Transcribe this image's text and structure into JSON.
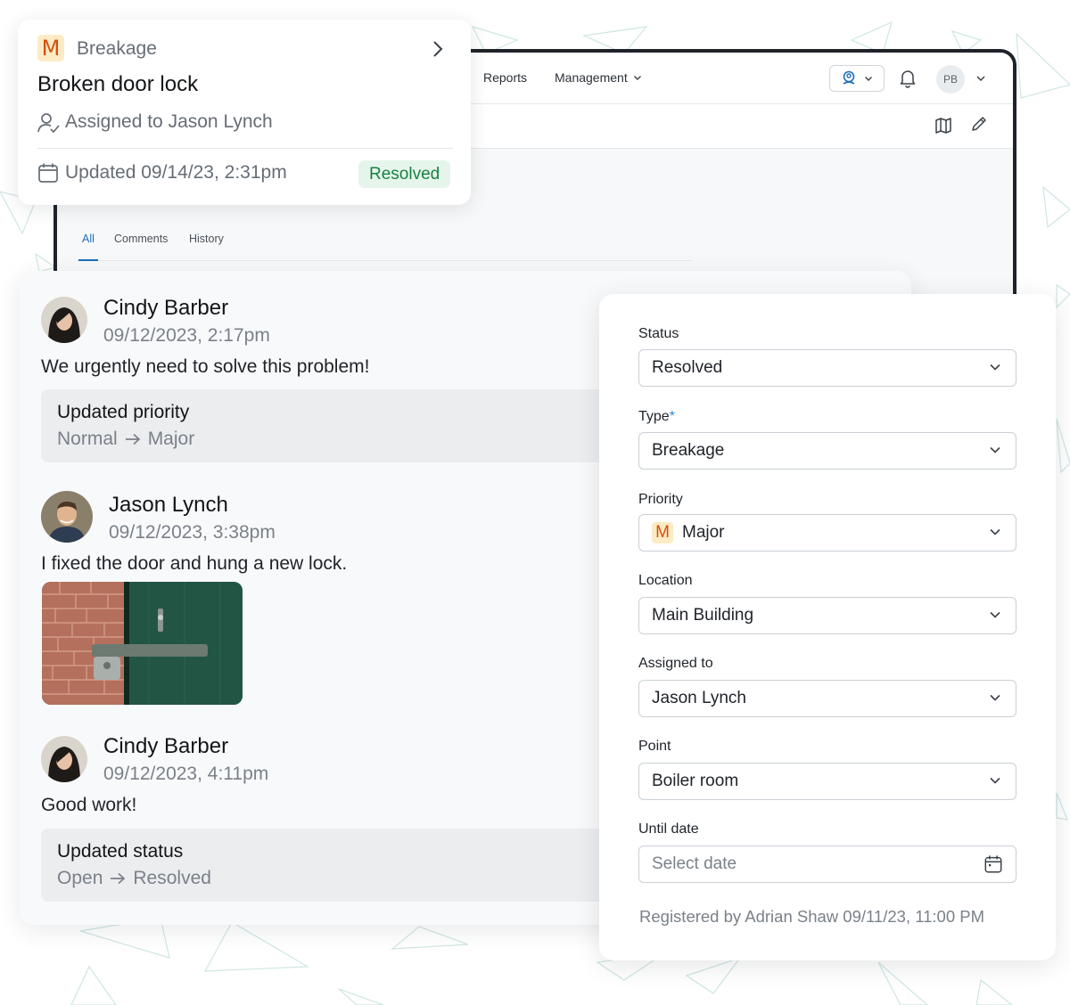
{
  "app": {
    "nav": {
      "reports": "Reports",
      "management": "Management"
    },
    "user_initials": "PB",
    "tabs": [
      {
        "label": "All",
        "active": true
      },
      {
        "label": "Comments"
      },
      {
        "label": "History"
      }
    ]
  },
  "ticket": {
    "priority_letter": "M",
    "type": "Breakage",
    "title": "Broken door lock",
    "assigned": "Assigned to Jason Lynch",
    "updated": "Updated 09/14/23, 2:31pm",
    "status_badge": "Resolved"
  },
  "comments": [
    {
      "author": "Cindy Barber",
      "time": "09/12/2023, 2:17pm",
      "text": "We urgently need to solve this problem!",
      "change": {
        "title": "Updated priority",
        "from": "Normal",
        "to": "Major"
      }
    },
    {
      "author": "Jason Lynch",
      "time": "09/12/2023, 3:38pm",
      "text": "I fixed the door and hung a new lock."
    },
    {
      "author": "Cindy Barber",
      "time": "09/12/2023, 4:11pm",
      "text": "Good work!",
      "change": {
        "title": "Updated status",
        "from": "Open",
        "to": "Resolved"
      }
    }
  ],
  "form": {
    "status": {
      "label": "Status",
      "value": "Resolved"
    },
    "type": {
      "label": "Type",
      "required_mark": "*",
      "value": "Breakage"
    },
    "priority": {
      "label": "Priority",
      "badge": "M",
      "value": "Major"
    },
    "location": {
      "label": "Location",
      "value": "Main Building"
    },
    "assigned_to": {
      "label": "Assigned to",
      "value": "Jason Lynch"
    },
    "point": {
      "label": "Point",
      "value": "Boiler room"
    },
    "until_date": {
      "label": "Until date",
      "placeholder": "Select date"
    },
    "registered": "Registered by Adrian Shaw 09/11/23, 11:00 PM"
  },
  "colors": {
    "accent_blue": "#1e6fb8",
    "resolved_green": "#17823f",
    "priority_orange": "#d44f0f"
  }
}
